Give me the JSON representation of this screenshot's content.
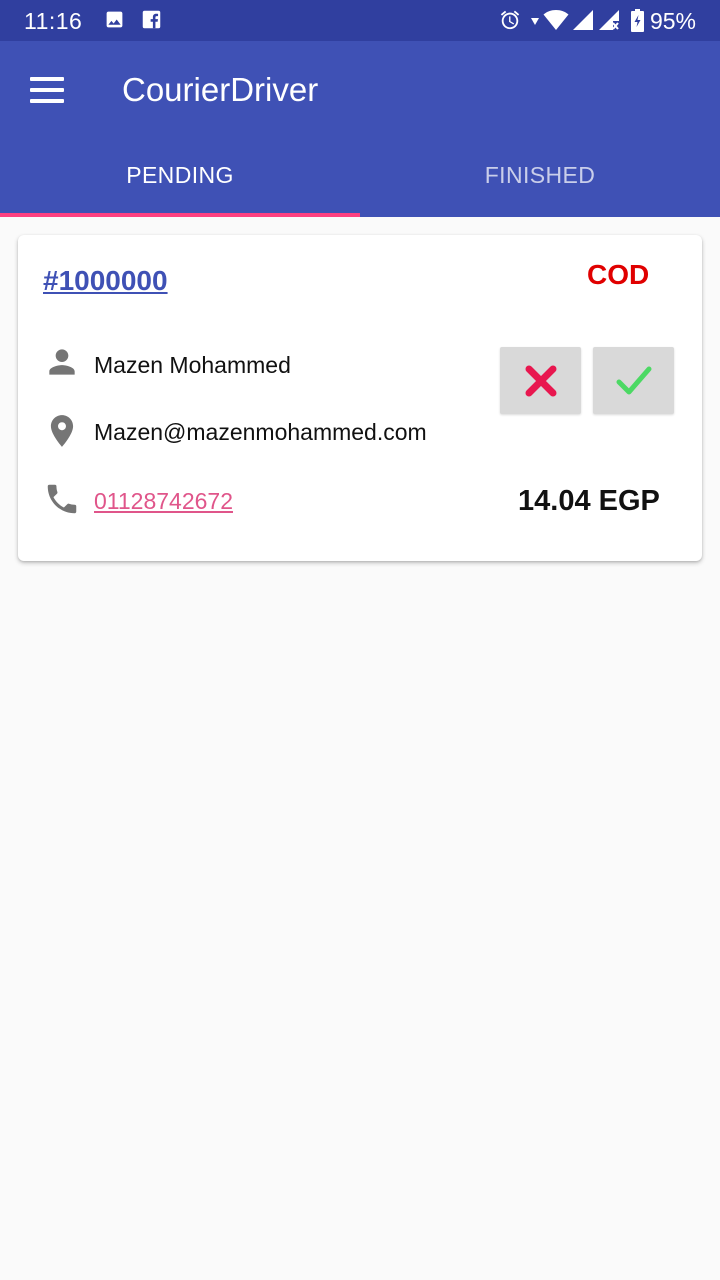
{
  "status_bar": {
    "time": "11:16",
    "battery": "95%",
    "icons": [
      "image-icon",
      "facebook-icon",
      "alarm-icon",
      "data-arrows-icon",
      "wifi-icon",
      "signal-icon",
      "signal-no-data-icon",
      "battery-icon"
    ]
  },
  "app_bar": {
    "title": "CourierDriver",
    "menu_icon": "hamburger-menu-icon"
  },
  "tabs": [
    {
      "label": "PENDING",
      "selected": true
    },
    {
      "label": "FINISHED",
      "selected": false
    }
  ],
  "colors": {
    "primary": "#3f51b5",
    "primary_dark": "#303f9f",
    "accent": "#ff4081",
    "cod": "#e00000",
    "reject": "#e8174f",
    "accept": "#4cd964",
    "phone_link": "#e0558a"
  },
  "order": {
    "id": "#1000000",
    "payment_type": "COD",
    "customer_name": "Mazen Mohammed",
    "address": "Mazen@mazenmohammed.com",
    "phone": "01128742672",
    "amount": "14.04 EGP",
    "icons": {
      "name": "person-icon",
      "address": "location-pin-icon",
      "phone": "phone-icon",
      "reject": "close-icon",
      "accept": "check-icon"
    }
  }
}
